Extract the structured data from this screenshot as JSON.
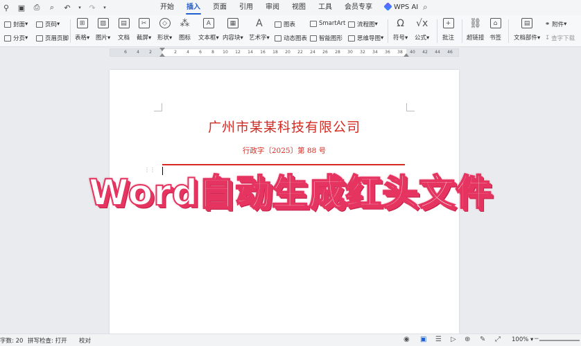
{
  "menubar": {
    "tabs": [
      {
        "label": "开始"
      },
      {
        "label": "插入"
      },
      {
        "label": "页面"
      },
      {
        "label": "引用"
      },
      {
        "label": "审阅"
      },
      {
        "label": "视图"
      },
      {
        "label": "工具"
      },
      {
        "label": "会员专享"
      },
      {
        "label": "WPS AI"
      }
    ],
    "active_tab": "插入"
  },
  "ribbon": {
    "cover": "封面",
    "page_number": "页码",
    "page_break": "分页",
    "header_footer": "页眉页脚",
    "table": "表格",
    "picture": "图片",
    "file": "文档",
    "screenshot": "截屏",
    "shape": "形状",
    "icon": "图标",
    "textbox": "文本框",
    "content_block": "内容块",
    "art_text": "艺术字",
    "chart": "图表",
    "smartart": "SmartArt",
    "flowchart": "流程图",
    "dynamic_chart": "动态图表",
    "smart_shape": "智能图形",
    "mindmap": "思维导图",
    "symbol": "符号",
    "formula": "公式",
    "comment": "批注",
    "hyperlink": "超链接",
    "bookmark": "书签",
    "attachment": "附件",
    "doc_parts": "文档部件",
    "more": "查字下载"
  },
  "ruler": {
    "ticks": [
      "6",
      "4",
      "2",
      "2",
      "4",
      "6",
      "8",
      "10",
      "12",
      "14",
      "16",
      "18",
      "20",
      "22",
      "24",
      "26",
      "28",
      "30",
      "32",
      "34",
      "36",
      "38",
      "40",
      "42",
      "44",
      "46"
    ]
  },
  "document": {
    "company": "广州市某某科技有限公司",
    "doc_number": "行政字〔2025〕第 88 号"
  },
  "overlay": {
    "title": "Word自动生成红头文件"
  },
  "statusbar": {
    "word_count": "字数: 20",
    "spell_check": "拼写检查: 打开",
    "proofread": "校对",
    "zoom": "100%"
  },
  "colors": {
    "header_red": "#d42a22",
    "overlay_pink": "#e5345f",
    "accent_blue": "#1f5fd1"
  }
}
